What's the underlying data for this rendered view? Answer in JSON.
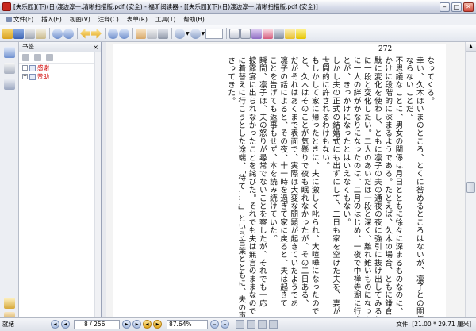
{
  "window": {
    "title": "[失乐园](下)(日)渡边淳一.清晰扫描版.pdf (安全) - 福昕阅读器 - [[失乐园](下)(日)渡边淳一.清晰扫描版.pdf (安全)]"
  },
  "menu": {
    "items": [
      "文件(F)",
      "插入(E)",
      "视图(V)",
      "注释(C)",
      "表单(R)",
      "工具(T)",
      "帮助(H)"
    ]
  },
  "toolbar": {
    "zoom_value": "",
    "icons": [
      "open-icon",
      "save-icon",
      "print-icon",
      "email-icon",
      "first-page-icon",
      "previous-page-icon",
      "back-icon",
      "forward-icon",
      "next-page-icon",
      "last-page-icon",
      "hand-tool-icon",
      "select-text-icon",
      "snapshot-icon",
      "zoom-out-icon",
      "zoom-in-icon",
      "fit-page-icon",
      "fit-width-icon",
      "rotate-icon",
      "bookmark-icon",
      "typewriter-icon",
      "note-icon",
      "highlight-icon"
    ]
  },
  "sidebar": {
    "title": "书签",
    "bookmarks": [
      {
        "label": "感谢",
        "expander": "+"
      },
      {
        "label": "赞助",
        "expander": "+"
      }
    ]
  },
  "document": {
    "page_number": "272",
    "columns": [
      "なってくる。",
      "幸い、久木はいまのところ、とくに咎めるところはないが、凛子との関係",
      "ならないことだ。",
      "不思議なことに、男女の関係は月日とともに徐々に深まるものなのに、",
      "かけに段階的に深まるようである。たとえば、久木の場合、ともに鎌倉へ行",
      "駄に変化を使わし、ともに凛子の夫の通夜の夜に強引に抜け出してみると、そ",
      "に一段と変化したい。二人のあいだは一段と深く、離れ難いものになった。",
      "に一人の絆がかなりになったのは、二月のはじめ、一夜で中禅寺湖に行き、",
      "とが、きっかけになったとはいえなくもない。",
      "しかし夫の正式の結婚式にも出ずにして、二日も家を空けた夫を、妻が",
      "世間的に許されるわけもない。",
      "もしかして家に帰ったときに、夫に激しく叱られ、大喧嘩になったので",
      "と、久木はそのことが気懸りで夜も眠れなかったが、その二日ある、",
      "だがそれはあくまで表面で、実際は大変な問題が起きていたようであ",
      "凛子の話によると、その夜、十一時を過ぎて家に戻ると、夫は起きて",
      "ことを告げても返事もせず、本を読み続けていた。",
      "瞬間、凛子は、夫の怒りが尋常でないことを察したが、それでも一応",
      "披露宴に出られなかったことを詫びた。それでも夫は無言のままなので",
      "に着替えに行こうとした途端、「待て……」という言葉とともに、夫の声",
      "さってきた。"
    ]
  },
  "status": {
    "ready": "就绪",
    "page_display": "8 / 256",
    "zoom": "87.64%",
    "page_size": "文件: [21.00 * 29.71 厘米]"
  }
}
